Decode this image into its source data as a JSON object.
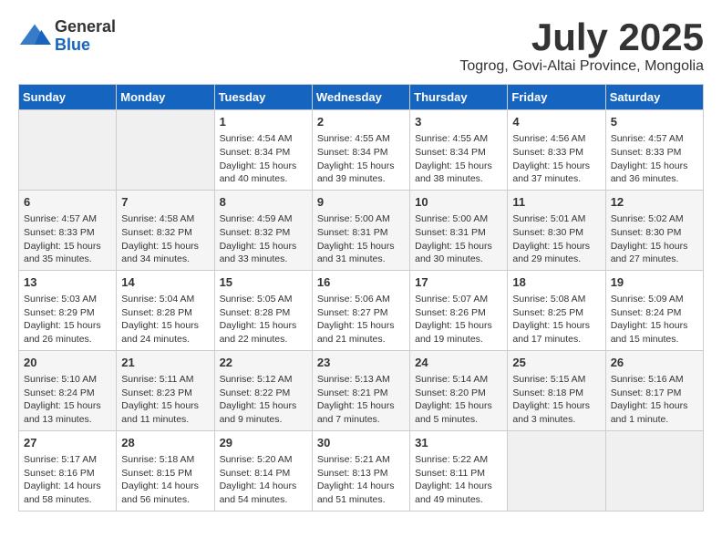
{
  "logo": {
    "general": "General",
    "blue": "Blue"
  },
  "header": {
    "month": "July 2025",
    "location": "Togrog, Govi-Altai Province, Mongolia"
  },
  "weekdays": [
    "Sunday",
    "Monday",
    "Tuesday",
    "Wednesday",
    "Thursday",
    "Friday",
    "Saturday"
  ],
  "weeks": [
    [
      {
        "day": "",
        "empty": true
      },
      {
        "day": "",
        "empty": true
      },
      {
        "day": "1",
        "sunrise": "4:54 AM",
        "sunset": "8:34 PM",
        "daylight": "15 hours and 40 minutes."
      },
      {
        "day": "2",
        "sunrise": "4:55 AM",
        "sunset": "8:34 PM",
        "daylight": "15 hours and 39 minutes."
      },
      {
        "day": "3",
        "sunrise": "4:55 AM",
        "sunset": "8:34 PM",
        "daylight": "15 hours and 38 minutes."
      },
      {
        "day": "4",
        "sunrise": "4:56 AM",
        "sunset": "8:33 PM",
        "daylight": "15 hours and 37 minutes."
      },
      {
        "day": "5",
        "sunrise": "4:57 AM",
        "sunset": "8:33 PM",
        "daylight": "15 hours and 36 minutes."
      }
    ],
    [
      {
        "day": "6",
        "sunrise": "4:57 AM",
        "sunset": "8:33 PM",
        "daylight": "15 hours and 35 minutes."
      },
      {
        "day": "7",
        "sunrise": "4:58 AM",
        "sunset": "8:32 PM",
        "daylight": "15 hours and 34 minutes."
      },
      {
        "day": "8",
        "sunrise": "4:59 AM",
        "sunset": "8:32 PM",
        "daylight": "15 hours and 33 minutes."
      },
      {
        "day": "9",
        "sunrise": "5:00 AM",
        "sunset": "8:31 PM",
        "daylight": "15 hours and 31 minutes."
      },
      {
        "day": "10",
        "sunrise": "5:00 AM",
        "sunset": "8:31 PM",
        "daylight": "15 hours and 30 minutes."
      },
      {
        "day": "11",
        "sunrise": "5:01 AM",
        "sunset": "8:30 PM",
        "daylight": "15 hours and 29 minutes."
      },
      {
        "day": "12",
        "sunrise": "5:02 AM",
        "sunset": "8:30 PM",
        "daylight": "15 hours and 27 minutes."
      }
    ],
    [
      {
        "day": "13",
        "sunrise": "5:03 AM",
        "sunset": "8:29 PM",
        "daylight": "15 hours and 26 minutes."
      },
      {
        "day": "14",
        "sunrise": "5:04 AM",
        "sunset": "8:28 PM",
        "daylight": "15 hours and 24 minutes."
      },
      {
        "day": "15",
        "sunrise": "5:05 AM",
        "sunset": "8:28 PM",
        "daylight": "15 hours and 22 minutes."
      },
      {
        "day": "16",
        "sunrise": "5:06 AM",
        "sunset": "8:27 PM",
        "daylight": "15 hours and 21 minutes."
      },
      {
        "day": "17",
        "sunrise": "5:07 AM",
        "sunset": "8:26 PM",
        "daylight": "15 hours and 19 minutes."
      },
      {
        "day": "18",
        "sunrise": "5:08 AM",
        "sunset": "8:25 PM",
        "daylight": "15 hours and 17 minutes."
      },
      {
        "day": "19",
        "sunrise": "5:09 AM",
        "sunset": "8:24 PM",
        "daylight": "15 hours and 15 minutes."
      }
    ],
    [
      {
        "day": "20",
        "sunrise": "5:10 AM",
        "sunset": "8:24 PM",
        "daylight": "15 hours and 13 minutes."
      },
      {
        "day": "21",
        "sunrise": "5:11 AM",
        "sunset": "8:23 PM",
        "daylight": "15 hours and 11 minutes."
      },
      {
        "day": "22",
        "sunrise": "5:12 AM",
        "sunset": "8:22 PM",
        "daylight": "15 hours and 9 minutes."
      },
      {
        "day": "23",
        "sunrise": "5:13 AM",
        "sunset": "8:21 PM",
        "daylight": "15 hours and 7 minutes."
      },
      {
        "day": "24",
        "sunrise": "5:14 AM",
        "sunset": "8:20 PM",
        "daylight": "15 hours and 5 minutes."
      },
      {
        "day": "25",
        "sunrise": "5:15 AM",
        "sunset": "8:18 PM",
        "daylight": "15 hours and 3 minutes."
      },
      {
        "day": "26",
        "sunrise": "5:16 AM",
        "sunset": "8:17 PM",
        "daylight": "15 hours and 1 minute."
      }
    ],
    [
      {
        "day": "27",
        "sunrise": "5:17 AM",
        "sunset": "8:16 PM",
        "daylight": "14 hours and 58 minutes."
      },
      {
        "day": "28",
        "sunrise": "5:18 AM",
        "sunset": "8:15 PM",
        "daylight": "14 hours and 56 minutes."
      },
      {
        "day": "29",
        "sunrise": "5:20 AM",
        "sunset": "8:14 PM",
        "daylight": "14 hours and 54 minutes."
      },
      {
        "day": "30",
        "sunrise": "5:21 AM",
        "sunset": "8:13 PM",
        "daylight": "14 hours and 51 minutes."
      },
      {
        "day": "31",
        "sunrise": "5:22 AM",
        "sunset": "8:11 PM",
        "daylight": "14 hours and 49 minutes."
      },
      {
        "day": "",
        "empty": true
      },
      {
        "day": "",
        "empty": true
      }
    ]
  ]
}
